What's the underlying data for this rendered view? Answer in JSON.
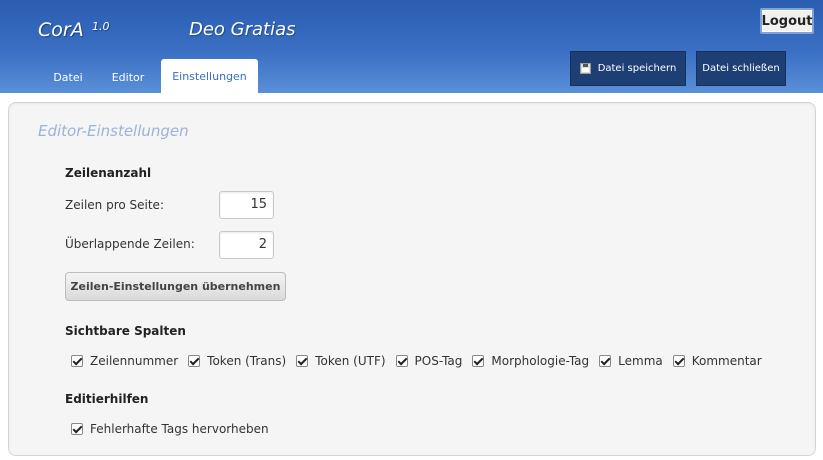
{
  "header": {
    "app_name": "CorA",
    "version": "1.0",
    "document_title": "Deo Gratias",
    "logout_label": "Logout",
    "tabs": [
      {
        "label": "Datei",
        "active": false
      },
      {
        "label": "Editor",
        "active": false
      },
      {
        "label": "Einstellungen",
        "active": true
      }
    ],
    "save_button": {
      "label": "Datei speichern",
      "icon": "floppy-disk-icon"
    },
    "close_button": {
      "label": "Datei schließen"
    }
  },
  "settings": {
    "title": "Editor-Einstellungen",
    "lines": {
      "heading": "Zeilenanzahl",
      "lines_per_page_label": "Zeilen pro Seite:",
      "lines_per_page_value": "15",
      "overlap_label": "Überlappende Zeilen:",
      "overlap_value": "2",
      "apply_label": "Zeilen-Einstellungen übernehmen"
    },
    "columns": {
      "heading": "Sichtbare Spalten",
      "items": [
        {
          "label": "Zeilennummer",
          "checked": true
        },
        {
          "label": "Token (Trans)",
          "checked": true
        },
        {
          "label": "Token (UTF)",
          "checked": true
        },
        {
          "label": "POS-Tag",
          "checked": true
        },
        {
          "label": "Morphologie-Tag",
          "checked": true
        },
        {
          "label": "Lemma",
          "checked": true
        },
        {
          "label": "Kommentar",
          "checked": true
        }
      ]
    },
    "helpers": {
      "heading": "Editierhilfen",
      "items": [
        {
          "label": "Fehlerhafte Tags hervorheben",
          "checked": true
        }
      ]
    }
  },
  "colors": {
    "header_blue": "#3a6fc4",
    "header_button": "#1e3f74",
    "panel_title": "#9ab3d8"
  }
}
